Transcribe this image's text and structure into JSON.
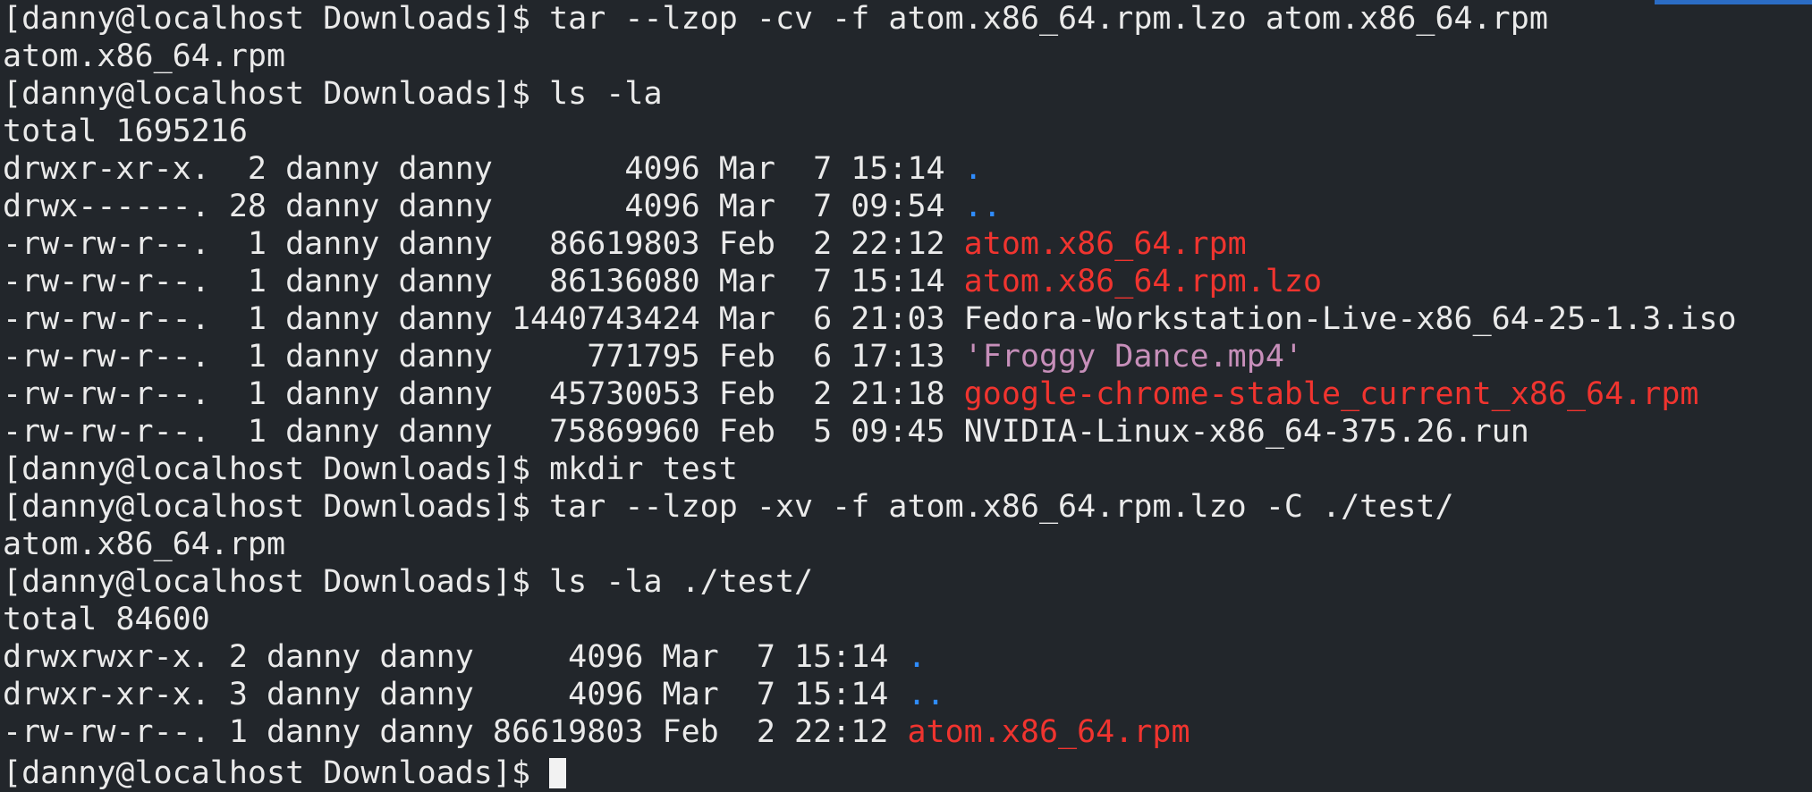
{
  "window": {
    "accent": "#2b6cc4"
  },
  "terminal": {
    "prompt": "[danny@localhost Downloads]$",
    "lines": [
      {
        "type": "cmd",
        "text": " tar --lzop -cv -f atom.x86_64.rpm.lzo atom.x86_64.rpm"
      },
      {
        "type": "out",
        "text": "atom.x86_64.rpm"
      },
      {
        "type": "cmd",
        "text": " ls -la"
      },
      {
        "type": "out",
        "text": "total 1695216"
      },
      {
        "type": "ls",
        "meta": "drwxr-xr-x.  2 danny danny       4096 Mar  7 15:14 ",
        "name": ".",
        "cls": "dir-link"
      },
      {
        "type": "ls",
        "meta": "drwx------. 28 danny danny       4096 Mar  7 09:54 ",
        "name": "..",
        "cls": "dir-link"
      },
      {
        "type": "ls",
        "meta": "-rw-rw-r--.  1 danny danny   86619803 Feb  2 22:12 ",
        "name": "atom.x86_64.rpm",
        "cls": "archive"
      },
      {
        "type": "ls",
        "meta": "-rw-rw-r--.  1 danny danny   86136080 Mar  7 15:14 ",
        "name": "atom.x86_64.rpm.lzo",
        "cls": "archive"
      },
      {
        "type": "ls",
        "meta": "-rw-rw-r--.  1 danny danny 1440743424 Mar  6 21:03 ",
        "name": "Fedora-Workstation-Live-x86_64-25-1.3.iso",
        "cls": "normal"
      },
      {
        "type": "ls",
        "meta": "-rw-rw-r--.  1 danny danny     771795 Feb  6 17:13 ",
        "name": "'Froggy Dance.mp4'",
        "cls": "media"
      },
      {
        "type": "ls",
        "meta": "-rw-rw-r--.  1 danny danny   45730053 Feb  2 21:18 ",
        "name": "google-chrome-stable_current_x86_64.rpm",
        "cls": "archive"
      },
      {
        "type": "ls",
        "meta": "-rw-rw-r--.  1 danny danny   75869960 Feb  5 09:45 ",
        "name": "NVIDIA-Linux-x86_64-375.26.run",
        "cls": "normal"
      },
      {
        "type": "cmd",
        "text": " mkdir test"
      },
      {
        "type": "cmd",
        "text": " tar --lzop -xv -f atom.x86_64.rpm.lzo -C ./test/"
      },
      {
        "type": "out",
        "text": "atom.x86_64.rpm"
      },
      {
        "type": "cmd",
        "text": " ls -la ./test/"
      },
      {
        "type": "out",
        "text": "total 84600"
      },
      {
        "type": "ls",
        "meta": "drwxrwxr-x. 2 danny danny     4096 Mar  7 15:14 ",
        "name": ".",
        "cls": "dir-link"
      },
      {
        "type": "ls",
        "meta": "drwxr-xr-x. 3 danny danny     4096 Mar  7 15:14 ",
        "name": "..",
        "cls": "dir-link"
      },
      {
        "type": "ls",
        "meta": "-rw-rw-r--. 1 danny danny 86619803 Feb  2 22:12 ",
        "name": "atom.x86_64.rpm",
        "cls": "archive"
      }
    ],
    "current_prompt": "[danny@localhost Downloads]$ "
  }
}
